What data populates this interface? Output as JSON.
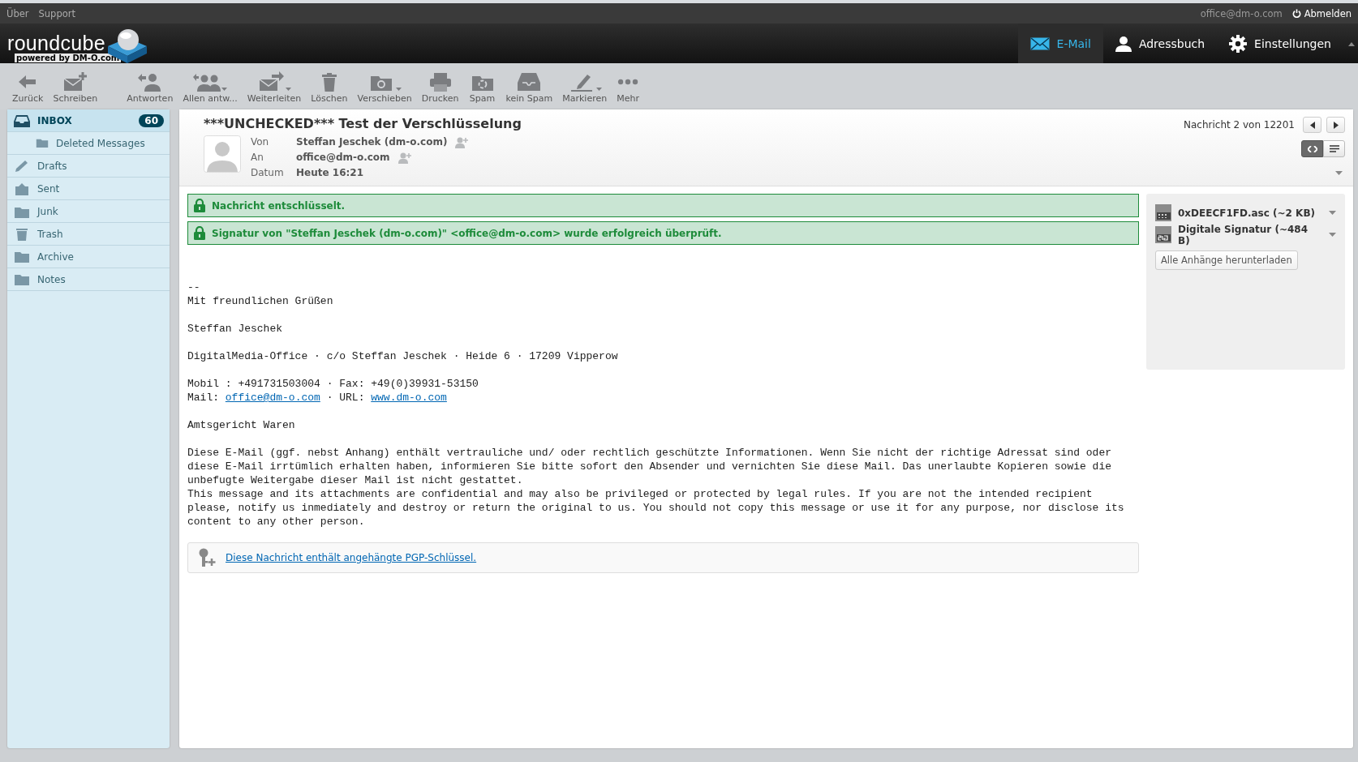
{
  "top_links": [
    "Über",
    "Support"
  ],
  "user": "office@dm-o.com",
  "logout": "Abmelden",
  "logo": {
    "name": "roundcube",
    "tagline": "powered by DM-O.com"
  },
  "nav": [
    {
      "label": "E-Mail",
      "selected": true
    },
    {
      "label": "Adressbuch",
      "selected": false
    },
    {
      "label": "Einstellungen",
      "selected": false
    }
  ],
  "toolbar": [
    {
      "label": "Zurück",
      "dropdown": false
    },
    {
      "label": "Schreiben",
      "dropdown": false
    },
    {
      "label": "Antworten",
      "dropdown": false
    },
    {
      "label": "Allen antw...",
      "dropdown": true
    },
    {
      "label": "Weiterleiten",
      "dropdown": true
    },
    {
      "label": "Löschen",
      "dropdown": false
    },
    {
      "label": "Verschieben",
      "dropdown": true
    },
    {
      "label": "Drucken",
      "dropdown": false
    },
    {
      "label": "Spam",
      "dropdown": false
    },
    {
      "label": "kein Spam",
      "dropdown": false
    },
    {
      "label": "Markieren",
      "dropdown": true
    },
    {
      "label": "Mehr",
      "dropdown": false
    }
  ],
  "folders": [
    {
      "name": "INBOX",
      "selected": true,
      "count": "60",
      "children": [
        {
          "name": "Deleted Messages",
          "selected": false
        }
      ]
    },
    {
      "name": "Drafts",
      "selected": false
    },
    {
      "name": "Sent",
      "selected": false
    },
    {
      "name": "Junk",
      "selected": false
    },
    {
      "name": "Trash",
      "selected": false
    },
    {
      "name": "Archive",
      "selected": false
    },
    {
      "name": "Notes",
      "selected": false
    }
  ],
  "message": {
    "subject": "***UNCHECKED*** Test der Verschlüsselung",
    "headers": [
      {
        "label": "Von",
        "value": "Steffan Jeschek (dm-o.com)",
        "add_contact": true
      },
      {
        "label": "An",
        "value": "office@dm-o.com",
        "add_contact": true
      },
      {
        "label": "Datum",
        "value": "Heute 16:21",
        "add_contact": false
      }
    ],
    "position": "Nachricht 2 von 12201",
    "view_modes": [
      {
        "kind": "html",
        "selected": true
      },
      {
        "kind": "plain",
        "selected": false
      }
    ],
    "notices": [
      "Nachricht entschlüsselt.",
      "Signatur von \"Steffan Jeschek (dm-o.com)\" <office@dm-o.com> wurde erfolgreich überprüft."
    ],
    "body": [
      [
        "--",
        "Mit freundlichen Grüßen"
      ],
      [
        "Steffan Jeschek"
      ],
      [
        "DigitalMedia-Office · c/o Steffan Jeschek · Heide 6 · 17209 Vipperow"
      ],
      [
        "Mobil : +491731503004 · Fax: +49(0)39931-53150",
        {
          "parts": [
            {
              "text": "Mail: ",
              "link": false
            },
            {
              "text": "office@dm-o.com",
              "link": true
            },
            {
              "text": " · URL: ",
              "link": false
            },
            {
              "text": "www.dm-o.com",
              "link": true
            }
          ]
        }
      ],
      [
        "Amtsgericht Waren"
      ],
      [
        "Diese E-Mail (ggf. nebst Anhang) enthält vertrauliche und/ oder rechtlich geschützte Informationen. Wenn Sie nicht der richtige Adressat sind oder diese E-Mail irrtümlich erhalten haben, informieren Sie bitte sofort den Absender und vernichten Sie diese Mail. Das unerlaubte Kopieren sowie die unbefugte Weitergabe dieser Mail ist nicht gestattet.",
        "This message and its attachments are confidential and may also be privileged or protected by legal rules. If you are not the intended recipient please, notify us inmediately and destroy or return the original to us. You should not copy this message or use it for any purpose, nor disclose its content to any other person."
      ]
    ],
    "pgp_notice": "Diese Nachricht enthält angehängte PGP-Schlüssel.",
    "attachments": [
      {
        "name": "0xDEECF1FD.asc (~2 KB)",
        "kind": "unknown"
      },
      {
        "name": "Digitale Signatur (~484 B)",
        "kind": "signature"
      }
    ],
    "download_all": "Alle Anhänge herunterladen"
  }
}
